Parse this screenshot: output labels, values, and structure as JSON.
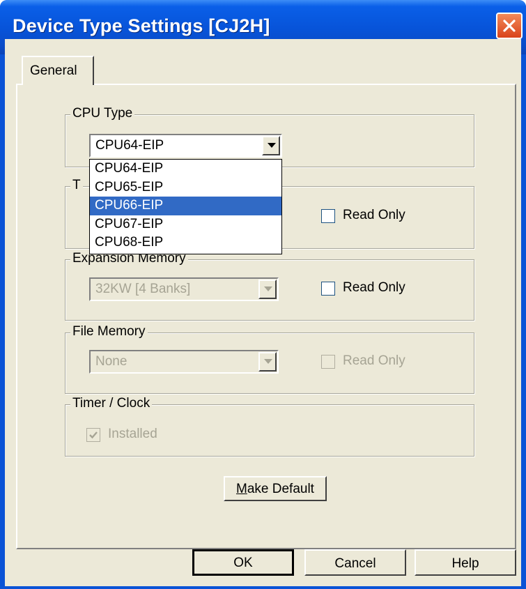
{
  "window": {
    "title": "Device Type Settings [CJ2H]"
  },
  "tabs": [
    {
      "label": "General"
    }
  ],
  "cpu_type": {
    "group_label": "CPU Type",
    "selected": "CPU64-EIP",
    "options": [
      "CPU64-EIP",
      "CPU65-EIP",
      "CPU66-EIP",
      "CPU67-EIP",
      "CPU68-EIP"
    ],
    "highlighted": "CPU66-EIP"
  },
  "second_group": {
    "label_visible": "T",
    "read_only_label": "Read Only"
  },
  "expansion_memory": {
    "group_label": "Expansion Memory",
    "selected": "32KW [4 Banks]",
    "read_only_label": "Read Only"
  },
  "file_memory": {
    "group_label": "File Memory",
    "selected": "None",
    "read_only_label": "Read Only"
  },
  "timer_clock": {
    "group_label": "Timer / Clock",
    "installed_label": "Installed",
    "installed_checked": true
  },
  "buttons": {
    "make_default_prefix": "M",
    "make_default_rest": "ake Default",
    "ok": "OK",
    "cancel": "Cancel",
    "help": "Help"
  },
  "colors": {
    "titlebar": "#0a53d6",
    "selection": "#316ac5",
    "dialog_bg": "#ece9d8",
    "close_button": "#d9431a"
  }
}
